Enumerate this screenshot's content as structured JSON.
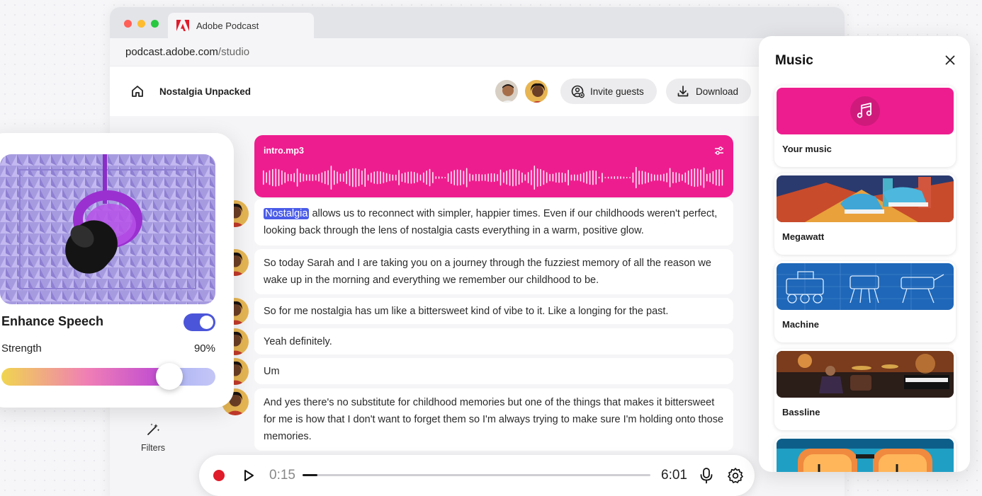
{
  "browser": {
    "tab_title": "Adobe Podcast",
    "url_domain": "podcast.adobe.com",
    "url_path": "/studio"
  },
  "header": {
    "project_title": "Nostalgia Unpacked",
    "invite_label": "Invite guests",
    "download_label": "Download"
  },
  "clip": {
    "name": "intro.mp3",
    "color": "#ee1d8f"
  },
  "transcript": [
    {
      "highlight": "Nostalgia",
      "text": " allows us to reconnect with simpler, happier times. Even if our childhoods weren't perfect, looking back through the lens of nostalgia casts everything in a warm, positive glow."
    },
    {
      "text": "So today Sarah and I are taking you on a journey through the fuzziest memory of all the reason we wake up in the morning and everything we remember our childhood to be."
    },
    {
      "text": "So for me nostalgia has um like a bittersweet kind of vibe to it. Like a longing for the past."
    },
    {
      "text": "Yeah definitely."
    },
    {
      "text": "Um"
    },
    {
      "text": "And yes there's no substitute for childhood memories but one of the things that makes it bittersweet for me is how that I don't want to forget them so I'm always trying to make sure I'm holding onto those memories."
    }
  ],
  "sidebar": {
    "filters_label": "Filters"
  },
  "player": {
    "current_time": "0:15",
    "total_time": "6:01",
    "progress": 0.042
  },
  "enhance": {
    "title": "Enhance Speech",
    "enabled": true,
    "strength_label": "Strength",
    "strength_value": "90%",
    "accent": "#4b55d9"
  },
  "music": {
    "title": "Music",
    "items": [
      {
        "label": "Your music",
        "icon": "music-note-icon"
      },
      {
        "label": "Megawatt"
      },
      {
        "label": "Machine"
      },
      {
        "label": "Bassline"
      },
      {
        "label": ""
      }
    ]
  }
}
